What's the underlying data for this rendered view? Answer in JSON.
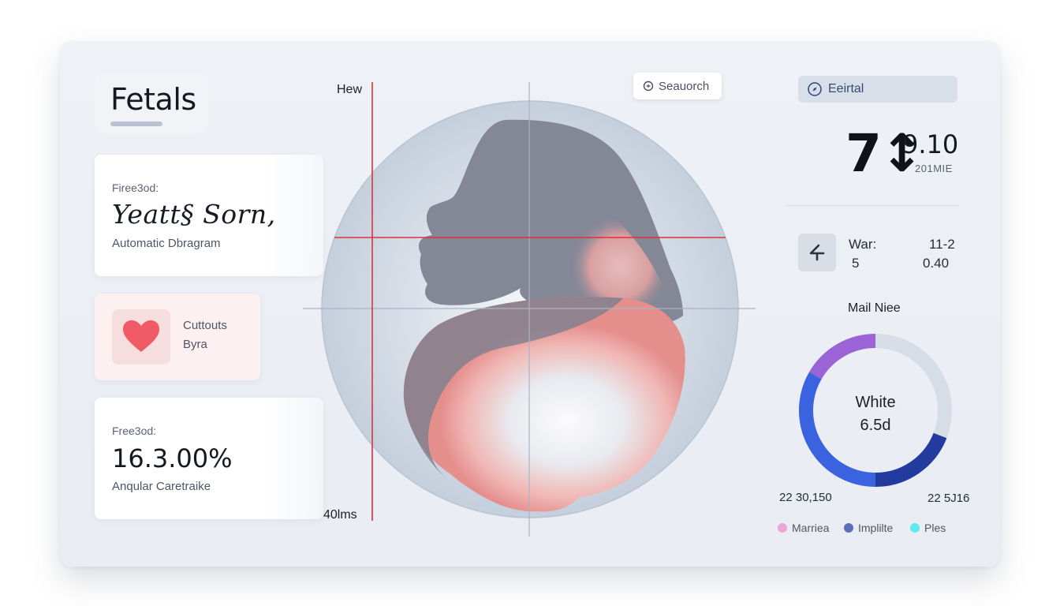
{
  "brand": {
    "title": "Fetals"
  },
  "card1": {
    "label": "Firee3od:",
    "title": "Yeatt§ Sorn,",
    "subtitle": "Automatic Dbragram"
  },
  "card2": {
    "line1": "Cuttouts",
    "line2": "Byra",
    "icon": "heart-icon"
  },
  "card3": {
    "label": "Free3od:",
    "value": "16.3.00%",
    "subtitle": "Anqular Caretraike"
  },
  "scan": {
    "top_label": "Hew",
    "bottom_label": "40lms"
  },
  "search": {
    "label": "Seauorch",
    "icon": "search-icon"
  },
  "top_pill": {
    "label": "Eeirtal",
    "icon": "compass-icon"
  },
  "readout": {
    "main": "7↕9.10",
    "big": "7↕",
    "mid": "9.10",
    "sub": "201MIE"
  },
  "stats": {
    "war_label": "War:",
    "war_value": "5",
    "right_top": "11-2",
    "right_bottom": "0.40",
    "icon": "arrow-left-icon"
  },
  "donut": {
    "title": "Mail Niee",
    "center_line1": "White",
    "center_line2": "6.5d",
    "left_caption": "22 30,150",
    "right_caption": "22 5J16"
  },
  "legend": [
    {
      "label": "Marriea",
      "color": "#e9a6d4"
    },
    {
      "label": "Implilte",
      "color": "#5b6fb8"
    },
    {
      "label": "Ples",
      "color": "#5ee8ef"
    }
  ],
  "colors": {
    "accent_red": "#d8333b",
    "accent_blue": "#3b63e0",
    "accent_navy": "#233a9e",
    "accent_purple": "#9a63d6",
    "heart": "#f05a66"
  }
}
